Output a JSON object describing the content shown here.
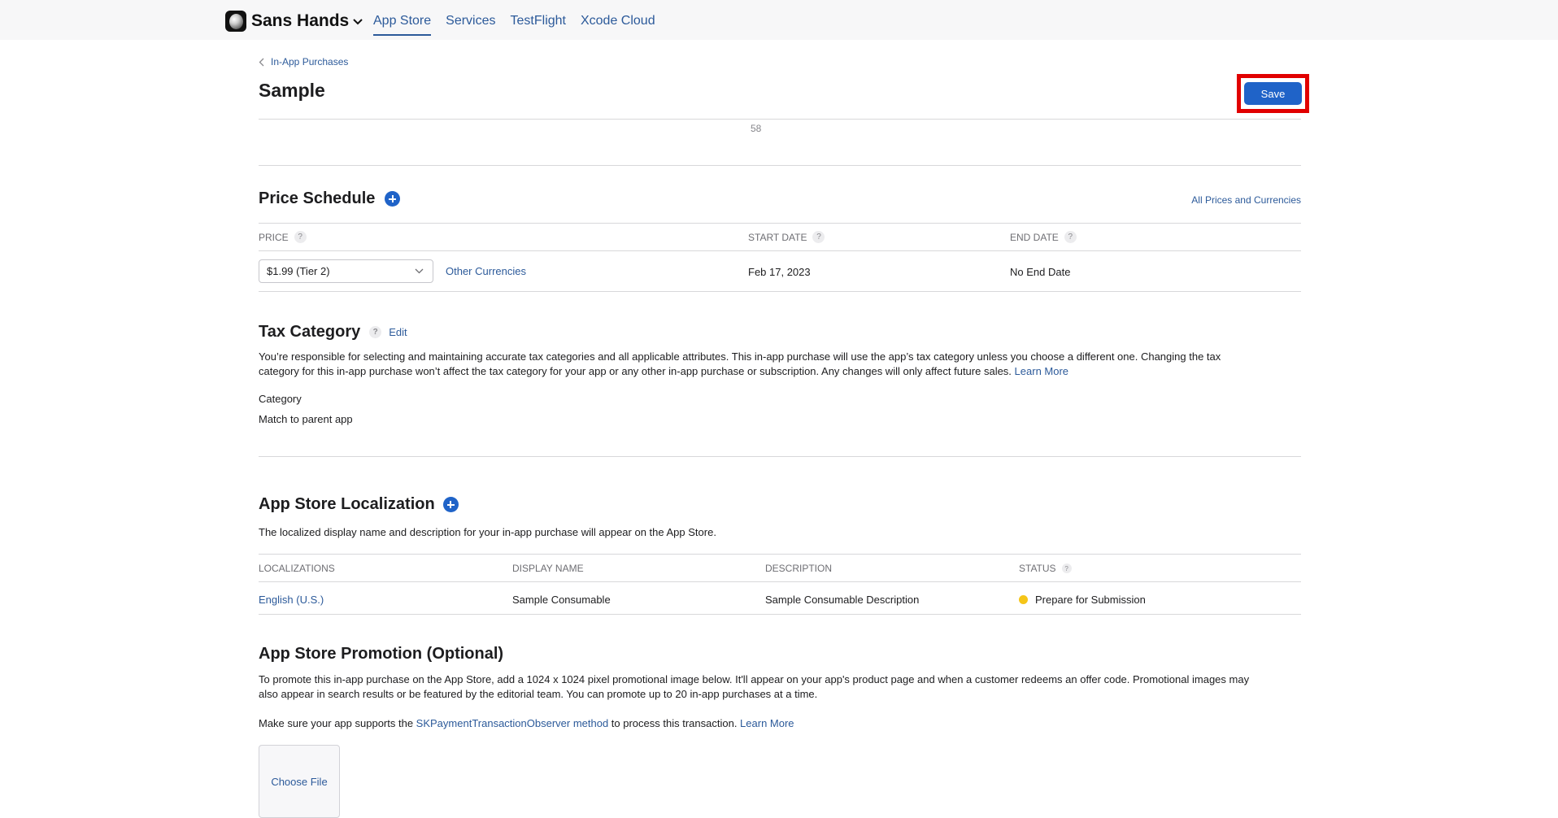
{
  "header": {
    "app_name": "Sans Hands",
    "tabs": [
      {
        "label": "App Store",
        "active": true
      },
      {
        "label": "Services",
        "active": false
      },
      {
        "label": "TestFlight",
        "active": false
      },
      {
        "label": "Xcode Cloud",
        "active": false
      }
    ]
  },
  "page": {
    "breadcrumb": "In-App Purchases",
    "title": "Sample",
    "save_label": "Save",
    "char_counter": "58"
  },
  "price_schedule": {
    "title": "Price Schedule",
    "all_prices_link": "All Prices and Currencies",
    "columns": [
      "PRICE",
      "START DATE",
      "END DATE"
    ],
    "price_value": "$1.99 (Tier 2)",
    "other_currencies_link": "Other Currencies",
    "start_date": "Feb 17, 2023",
    "end_date": "No End Date"
  },
  "tax_category": {
    "title": "Tax Category",
    "edit_label": "Edit",
    "description_line1": "You’re responsible for selecting and maintaining accurate tax categories and all applicable attributes. This in-app purchase will use the app’s tax category unless you choose a different one. Changing the tax",
    "description_line2": "category for this in-app purchase won’t affect the tax category for your app or any other in-app purchase or subscription. Any changes will only affect future sales.",
    "learn_more": "Learn More",
    "category_label": "Category",
    "category_value": "Match to parent app"
  },
  "localization": {
    "title": "App Store Localization",
    "description": "The localized display name and description for your in-app purchase will appear on the App Store.",
    "columns": [
      "LOCALIZATIONS",
      "DISPLAY NAME",
      "DESCRIPTION",
      "STATUS"
    ],
    "rows": [
      {
        "locale": "English (U.S.)",
        "display_name": "Sample Consumable",
        "description": "Sample Consumable Description",
        "status": "Prepare for Submission",
        "status_color": "#f5c518"
      }
    ]
  },
  "promotion": {
    "title": "App Store Promotion (Optional)",
    "description_line1": "To promote this in-app purchase on the App Store, add a 1024 x 1024 pixel promotional image below. It'll appear on your app's product page and when a customer redeems an offer code. Promotional images may",
    "description_line2": "also appear in search results or be featured by the editorial team. You can promote up to 20 in-app purchases at a time.",
    "support_prefix": "Make sure your app supports the ",
    "support_link": "SKPaymentTransactionObserver method",
    "support_suffix": " to process this transaction. ",
    "learn_more": "Learn More",
    "choose_file_label": "Choose File"
  }
}
